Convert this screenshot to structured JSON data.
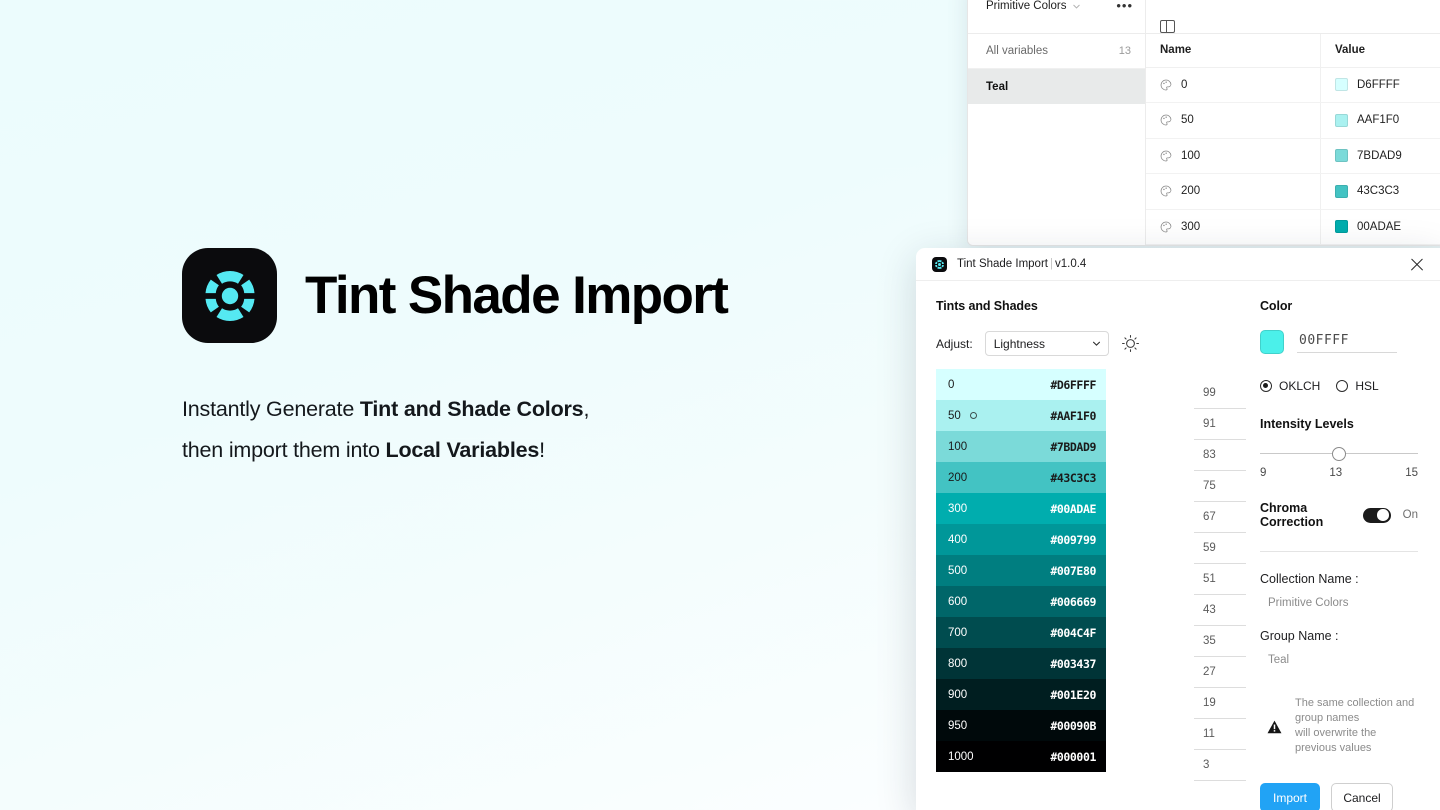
{
  "hero": {
    "title": "Tint Shade Import",
    "logo_icon": "tint-shade-logo-icon",
    "tagline_line1_a": "Instantly Generate ",
    "tagline_line1_b": "Tint and Shade Colors",
    "tagline_line1_c": ",",
    "tagline_line2_a": "then import them into ",
    "tagline_line2_b": "Local Variables",
    "tagline_line2_c": "!"
  },
  "figma_panel": {
    "collection_name": "Primitive Colors",
    "more_menu": "•••",
    "sidebar": {
      "all_variables_label": "All variables",
      "all_variables_count": "13",
      "group_label": "Teal"
    },
    "columns": {
      "name": "Name",
      "value": "Value"
    },
    "rows": [
      {
        "name": "0",
        "value": "D6FFFF",
        "color": "#D6FFFF"
      },
      {
        "name": "50",
        "value": "AAF1F0",
        "color": "#AAF1F0"
      },
      {
        "name": "100",
        "value": "7BDAD9",
        "color": "#7BDAD9"
      },
      {
        "name": "200",
        "value": "43C3C3",
        "color": "#43C3C3"
      },
      {
        "name": "300",
        "value": "00ADAE",
        "color": "#00ADAE"
      }
    ]
  },
  "modal": {
    "title": "Tint Shade Import",
    "title_separator": "|",
    "version": "v1.0.4",
    "close_label": "×",
    "left": {
      "section_title": "Tints and Shades",
      "adjust_label": "Adjust:",
      "adjust_value": "Lightness",
      "adjust_options": [
        "Lightness"
      ],
      "brightness_icon": "sun-icon",
      "swatches": [
        {
          "step": "0",
          "hex": "#D6FFFF",
          "bg": "#D6FFFF",
          "fg": "#1a1a1a",
          "intensity": "99",
          "marker": false
        },
        {
          "step": "50",
          "hex": "#AAF1F0",
          "bg": "#AAF1F0",
          "fg": "#1a1a1a",
          "intensity": "91",
          "marker": true
        },
        {
          "step": "100",
          "hex": "#7BDAD9",
          "bg": "#7BDAD9",
          "fg": "#1a1a1a",
          "intensity": "83",
          "marker": false
        },
        {
          "step": "200",
          "hex": "#43C3C3",
          "bg": "#43C3C3",
          "fg": "#1a1a1a",
          "intensity": "75",
          "marker": false
        },
        {
          "step": "300",
          "hex": "#00ADAE",
          "bg": "#00ADAE",
          "fg": "#ffffff",
          "intensity": "67",
          "marker": false
        },
        {
          "step": "400",
          "hex": "#009799",
          "bg": "#009799",
          "fg": "#ffffff",
          "intensity": "59",
          "marker": false
        },
        {
          "step": "500",
          "hex": "#007E80",
          "bg": "#007E80",
          "fg": "#ffffff",
          "intensity": "51",
          "marker": false
        },
        {
          "step": "600",
          "hex": "#006669",
          "bg": "#006669",
          "fg": "#ffffff",
          "intensity": "43",
          "marker": false
        },
        {
          "step": "700",
          "hex": "#004C4F",
          "bg": "#004C4F",
          "fg": "#ffffff",
          "intensity": "35",
          "marker": false
        },
        {
          "step": "800",
          "hex": "#003437",
          "bg": "#003437",
          "fg": "#ffffff",
          "intensity": "27",
          "marker": false
        },
        {
          "step": "900",
          "hex": "#001E20",
          "bg": "#001E20",
          "fg": "#ffffff",
          "intensity": "19",
          "marker": false
        },
        {
          "step": "950",
          "hex": "#00090B",
          "bg": "#00090B",
          "fg": "#ffffff",
          "intensity": "11",
          "marker": false
        },
        {
          "step": "1000",
          "hex": "#000001",
          "bg": "#000001",
          "fg": "#ffffff",
          "intensity": "3",
          "marker": false
        }
      ]
    },
    "right": {
      "color_label": "Color",
      "color_value": "00FFFF",
      "color_swatch": "#4BF0EA",
      "mode_oklch": "OKLCH",
      "mode_hsl": "HSL",
      "mode_selected": "OKLCH",
      "intensity_title": "Intensity Levels",
      "intensity_min": "9",
      "intensity_current": "13",
      "intensity_max": "15",
      "chroma_label": "Chroma Correction",
      "chroma_state": "On",
      "collection_name_label": "Collection Name :",
      "collection_name_value": "Primitive Colors",
      "group_name_label": "Group Name :",
      "group_name_value": "Teal",
      "warning_icon": "warning-triangle-icon",
      "warning_line1": "The same collection and group names",
      "warning_line2": "will overwrite the previous values",
      "import_label": "Import",
      "cancel_label": "Cancel",
      "accent_color": "#21a3f5"
    }
  }
}
